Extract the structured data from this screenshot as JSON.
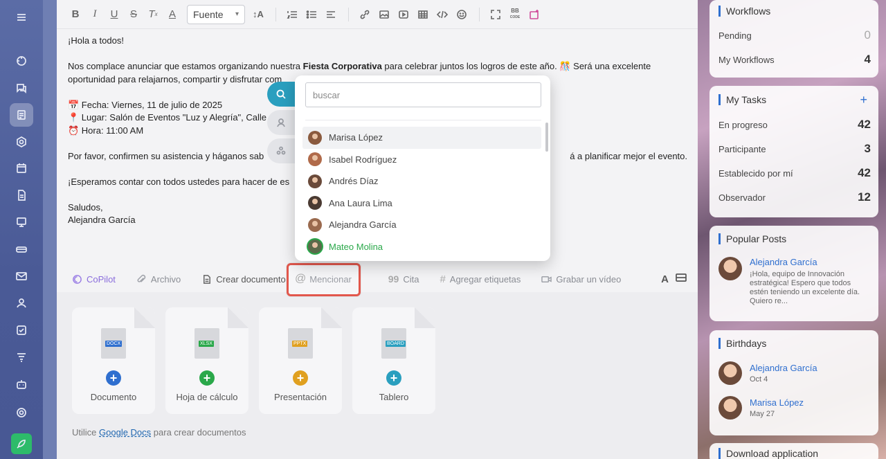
{
  "toolbar": {
    "font_select": "Fuente",
    "bb_code_top": "BB",
    "bb_code_bottom": "CODE"
  },
  "message": {
    "greeting": "¡Hola a todos!",
    "para1_before": "Nos complace anunciar que estamos organizando nuestra ",
    "para1_bold": "Fiesta Corporativa",
    "para1_after": " para celebrar juntos los logros de este año. 🎊 Será una excelente",
    "para1_line2": "oportunidad para relajarnos, compartir y disfrutar com",
    "date_line": "📅 Fecha: Viernes, 11 de julio de 2025",
    "place_line": "📍 Lugar: Salón de Eventos \"Luz y Alegría\", Calle",
    "time_line": "⏰ Hora: 11:00 AM",
    "para2_before": "Por favor, confirmen su asistencia y háganos sab",
    "para2_after": "á a planificar mejor el evento.",
    "para3": "¡Esperamos contar con todos ustedes para hacer de es",
    "closing": "Saludos,",
    "signature": "Alejandra García"
  },
  "actions": {
    "copilot": "CoPilot",
    "file": "Archivo",
    "create_doc": "Crear documento",
    "mention": "Mencionar",
    "quote": "Cita",
    "tags": "Agregar etiquetas",
    "video": "Grabar un vídeo",
    "font_letter": "A"
  },
  "doc_cards": [
    {
      "label": "Documento",
      "tag": "DOCX",
      "tag_color": "#2f6fcf",
      "plus_color": "#2f6fcf"
    },
    {
      "label": "Hoja de cálculo",
      "tag": "XLSX",
      "tag_color": "#2aa84a",
      "plus_color": "#2aa84a"
    },
    {
      "label": "Presentación",
      "tag": "PPTX",
      "tag_color": "#e0a020",
      "plus_color": "#e0a020"
    },
    {
      "label": "Tablero",
      "tag": "BOARD",
      "tag_color": "#2a9fbf",
      "plus_color": "#2a9fbf"
    }
  ],
  "docs_note": {
    "before": "Utilice ",
    "link": "Google Docs",
    "after": " para crear documentos"
  },
  "mention_popup": {
    "search_placeholder": "buscar",
    "users": [
      {
        "name": "Marisa López",
        "highlighted": true
      },
      {
        "name": "Isabel Rodríguez"
      },
      {
        "name": "Andrés Díaz"
      },
      {
        "name": "Ana Laura Lima"
      },
      {
        "name": "Alejandra García"
      },
      {
        "name": "Mateo Molina",
        "selected": true
      }
    ]
  },
  "workflows": {
    "title": "Workflows",
    "rows": [
      {
        "label": "Pending",
        "value": "0"
      },
      {
        "label": "My Workflows",
        "value": "4"
      }
    ]
  },
  "tasks": {
    "title": "My Tasks",
    "rows": [
      {
        "label": "En progreso",
        "value": "42"
      },
      {
        "label": "Participante",
        "value": "3"
      },
      {
        "label": "Establecido por mí",
        "value": "42"
      },
      {
        "label": "Observador",
        "value": "12"
      }
    ]
  },
  "popular_posts": {
    "title": "Popular Posts",
    "author": "Alejandra García",
    "excerpt_l1": "¡Hola, equipo de Innovación",
    "excerpt_l2": "estratégica! Espero que todos",
    "excerpt_l3": "estén teniendo un excelente día.",
    "excerpt_l4": "Quiero re..."
  },
  "birthdays": {
    "title": "Birthdays",
    "people": [
      {
        "name": "Alejandra García",
        "date": "Oct 4"
      },
      {
        "name": "Marisa López",
        "date": "May 27"
      }
    ]
  },
  "download": {
    "title": "Download application"
  },
  "colors": {
    "accent": "#2f6fcf",
    "mention_highlight": "#e2574c",
    "selected_user": "#2aa84a",
    "sidebar": "#4a5a96"
  }
}
